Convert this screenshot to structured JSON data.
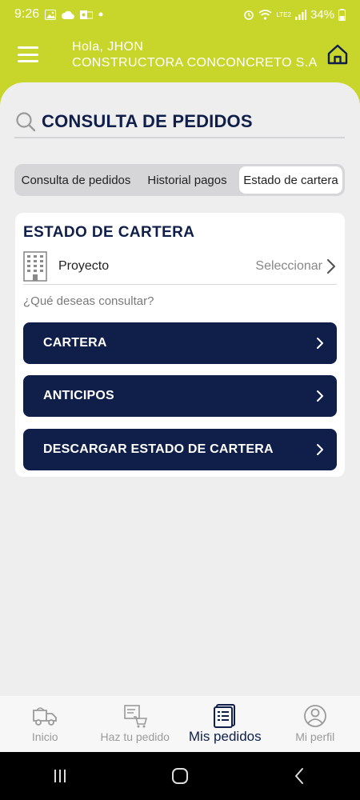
{
  "status_bar": {
    "time": "9:26",
    "battery": "34%",
    "network": "LTE2"
  },
  "header": {
    "greeting": "Hola, JHON",
    "company": "CONSTRUCTORA CONCONCRETO S.A"
  },
  "page": {
    "title": "CONSULTA DE PEDIDOS"
  },
  "tabs": [
    {
      "label": "Consulta de pedidos",
      "active": false
    },
    {
      "label": "Historial pagos",
      "active": false
    },
    {
      "label": "Estado de cartera",
      "active": true
    }
  ],
  "card": {
    "title": "ESTADO DE CARTERA",
    "project_label": "Proyecto",
    "project_value": "Seleccionar",
    "question": "¿Qué deseas consultar?",
    "buttons": [
      {
        "label": "CARTERA"
      },
      {
        "label": "ANTICIPOS"
      },
      {
        "label": "DESCARGAR ESTADO DE CARTERA"
      }
    ]
  },
  "bottom_nav": [
    {
      "label": "Inicio",
      "icon": "truck-icon",
      "active": false
    },
    {
      "label": "Haz tu pedido",
      "icon": "cart-icon",
      "active": false
    },
    {
      "label": "Mis pedidos",
      "icon": "orders-icon",
      "active": true
    },
    {
      "label": "Mi perfil",
      "icon": "profile-icon",
      "active": false
    }
  ],
  "colors": {
    "brand_lime": "#c8d62b",
    "brand_navy": "#0f1f4a",
    "background": "#eeeeef"
  }
}
